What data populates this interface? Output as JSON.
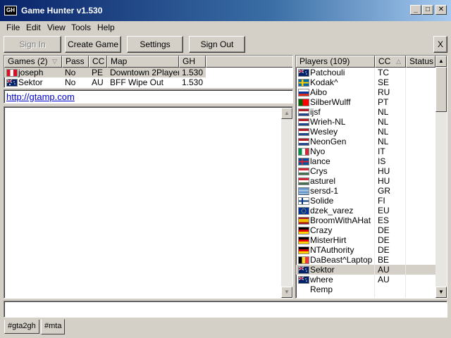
{
  "window": {
    "title": "Game Hunter v1.530",
    "icon_label": "GH"
  },
  "menu": [
    "File",
    "Edit",
    "View",
    "Tools",
    "Help"
  ],
  "toolbar": {
    "sign_in": "Sign In",
    "create_game": "Create Game",
    "settings": "Settings",
    "sign_out": "Sign Out",
    "close": "X"
  },
  "games": {
    "headers": [
      "Games (2)",
      "Pass",
      "CC",
      "Map",
      "GH"
    ],
    "rows": [
      {
        "name": "joseph",
        "pass": "No",
        "cc": "PE",
        "map": "Downtown 2Player",
        "gh": "1.530",
        "flag": "pe"
      },
      {
        "name": "Sektor",
        "pass": "No",
        "cc": "AU",
        "map": "BFF Wipe Out",
        "gh": "1.530",
        "flag": "au"
      }
    ]
  },
  "url": "http://gtamp.com",
  "players": {
    "headers": [
      "Players (109)",
      "CC",
      "Status"
    ],
    "rows": [
      {
        "name": "Patchouli",
        "cc": "TC",
        "flag": "tc"
      },
      {
        "name": "Kodak^",
        "cc": "SE",
        "flag": "se"
      },
      {
        "name": "Aibo",
        "cc": "RU",
        "flag": "ru"
      },
      {
        "name": "SilberWulff",
        "cc": "PT",
        "flag": "pt"
      },
      {
        "name": "ijsf",
        "cc": "NL",
        "flag": "nl"
      },
      {
        "name": "Wrieh-NL",
        "cc": "NL",
        "flag": "nl"
      },
      {
        "name": "Wesley",
        "cc": "NL",
        "flag": "nl"
      },
      {
        "name": "NeonGen",
        "cc": "NL",
        "flag": "nl"
      },
      {
        "name": "Nyo",
        "cc": "IT",
        "flag": "it"
      },
      {
        "name": "lance",
        "cc": "IS",
        "flag": "is"
      },
      {
        "name": "Crys",
        "cc": "HU",
        "flag": "hu"
      },
      {
        "name": "asturel",
        "cc": "HU",
        "flag": "hu"
      },
      {
        "name": "sersd-1",
        "cc": "GR",
        "flag": "gr"
      },
      {
        "name": "Solide",
        "cc": "FI",
        "flag": "fi"
      },
      {
        "name": "dzek_varez",
        "cc": "EU",
        "flag": "eu"
      },
      {
        "name": "BroomWithAHat",
        "cc": "ES",
        "flag": "es"
      },
      {
        "name": "Crazy",
        "cc": "DE",
        "flag": "de"
      },
      {
        "name": "MisterHirt",
        "cc": "DE",
        "flag": "de"
      },
      {
        "name": "NTAuthority",
        "cc": "DE",
        "flag": "de"
      },
      {
        "name": "DaBeast^Laptop",
        "cc": "BE",
        "flag": "be"
      },
      {
        "name": "Sektor",
        "cc": "AU",
        "flag": "au",
        "selected": true
      },
      {
        "name": "where",
        "cc": "AU",
        "flag": "au"
      },
      {
        "name": "Remp",
        "cc": "",
        "flag": ""
      }
    ]
  },
  "tabs": [
    "#gta2gh",
    "#mta"
  ]
}
